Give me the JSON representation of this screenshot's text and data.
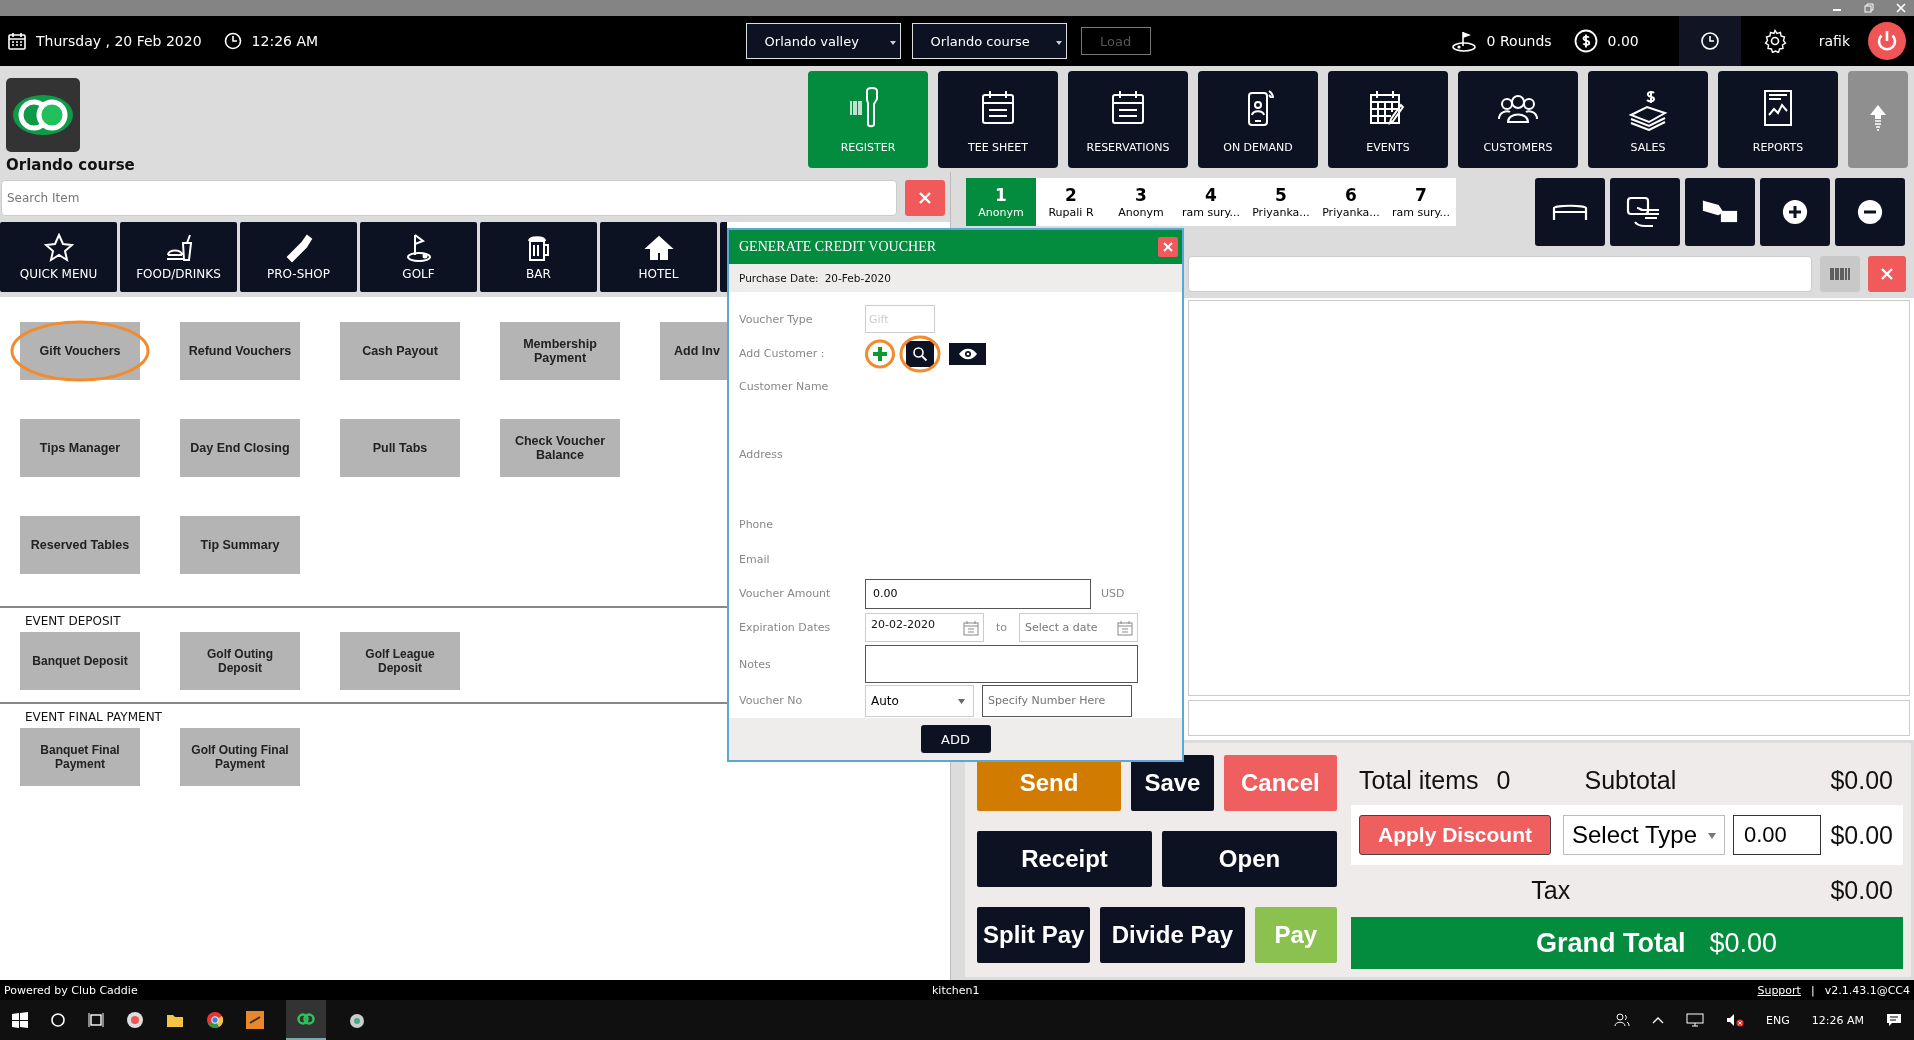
{
  "header": {
    "date": "Thursday ,  20 Feb 2020",
    "time": "12:26 AM",
    "location_select": "Orlando valley",
    "course_select": "Orlando course",
    "load_button": {
      "label": "Load",
      "disabled": true
    },
    "rounds": "0 Rounds",
    "balance": "0.00",
    "user": "rafik"
  },
  "brand": {
    "name": "Orlando course"
  },
  "nav": [
    {
      "label": "REGISTER",
      "selected": true
    },
    {
      "label": "TEE SHEET",
      "selected": false
    },
    {
      "label": "RESERVATIONS",
      "selected": false
    },
    {
      "label": "ON DEMAND",
      "selected": false
    },
    {
      "label": "EVENTS",
      "selected": false
    },
    {
      "label": "CUSTOMERS",
      "selected": false
    },
    {
      "label": "SALES",
      "selected": false
    },
    {
      "label": "REPORTS",
      "selected": false
    }
  ],
  "search": {
    "placeholder": "Search Item"
  },
  "categories": [
    "QUICK MENU",
    "FOOD/DRINKS",
    "PRO-SHOP",
    "GOLF",
    "BAR",
    "HOTEL"
  ],
  "tile_rows": [
    [
      {
        "label": "Gift Vouchers",
        "highlighted": true
      },
      {
        "label": "Refund Vouchers",
        "highlighted": false
      },
      {
        "label": "Cash Payout",
        "highlighted": false
      },
      {
        "label": "Membership Payment",
        "highlighted": false
      },
      {
        "label": "Add Inv",
        "highlighted": false
      }
    ],
    [
      {
        "label": "Tips Manager",
        "highlighted": false
      },
      {
        "label": "Day End Closing",
        "highlighted": false
      },
      {
        "label": "Pull Tabs",
        "highlighted": false
      },
      {
        "label": "Check Voucher Balance",
        "highlighted": false
      }
    ],
    [
      {
        "label": "Reserved Tables",
        "highlighted": false
      },
      {
        "label": "Tip Summary",
        "highlighted": false
      }
    ]
  ],
  "sections": [
    {
      "title": "EVENT DEPOSIT",
      "tiles": [
        "Banquet Deposit",
        "Golf Outing Deposit",
        "Golf League Deposit"
      ]
    },
    {
      "title": "EVENT FINAL PAYMENT",
      "tiles": [
        "Banquet Final Payment",
        "Golf Outing Final Payment"
      ]
    }
  ],
  "order_tabs": [
    {
      "number": "1",
      "name": "Anonym",
      "selected": true
    },
    {
      "number": "2",
      "name": "Rupali R",
      "selected": false
    },
    {
      "number": "3",
      "name": "Anonym",
      "selected": false
    },
    {
      "number": "4",
      "name": "ram sury...",
      "selected": false
    },
    {
      "number": "5",
      "name": "Priyanka...",
      "selected": false
    },
    {
      "number": "6",
      "name": "Priyanka...",
      "selected": false
    },
    {
      "number": "7",
      "name": "ram sury...",
      "selected": false
    }
  ],
  "actions": [
    {
      "label": "Send",
      "kind": "orange"
    },
    {
      "label": "Save",
      "kind": "dark"
    },
    {
      "label": "Cancel",
      "kind": "red"
    },
    {
      "label": "Receipt",
      "kind": "dark"
    },
    {
      "label": "Open",
      "kind": "dark"
    },
    {
      "label": "Split Pay",
      "kind": "dark"
    },
    {
      "label": "Divide Pay",
      "kind": "dark"
    },
    {
      "label": "Pay",
      "kind": "lime"
    }
  ],
  "totals": {
    "items_label": "Total items",
    "items_count": "0",
    "subtotal_label": "Subtotal",
    "subtotal": "$0.00",
    "discount_button": "Apply Discount",
    "discount_type": "Select Type",
    "discount_value": "0.00",
    "discount_amount": "$0.00",
    "tax_label": "Tax",
    "tax": "$0.00",
    "grand_total_label": "Grand Total",
    "grand_total": "$0.00"
  },
  "dialog": {
    "title": "GENERATE CREDIT VOUCHER",
    "purchase_date_label": "Purchase Date:",
    "purchase_date": "20-Feb-2020",
    "voucher_type_label": "Voucher Type",
    "voucher_type_placeholder": "Gift",
    "add_customer_label": "Add Customer :",
    "add_customer_highlighted": true,
    "search_customer_highlighted": true,
    "customer_name_label": "Customer Name",
    "address_label": "Address",
    "phone_label": "Phone",
    "email_label": "Email",
    "amount_label": "Voucher Amount",
    "amount": "0.00",
    "currency": "USD",
    "expiration_label": "Expiration Dates",
    "expiration_from": "20-02-2020",
    "to_label": "to",
    "expiration_to_placeholder": "Select a date",
    "notes_label": "Notes",
    "voucher_no_label": "Voucher No",
    "voucher_no_select": "Auto",
    "voucher_no_placeholder": "Specify Number Here",
    "add_button": "ADD"
  },
  "footer": {
    "powered_by": "Powered by Club Caddie",
    "terminal": "kitchen1",
    "support_link": "Support",
    "separator": "|",
    "version": "v2.1.43.1@CC4"
  },
  "taskbar": {
    "language": "ENG",
    "time": "12:26 AM"
  }
}
